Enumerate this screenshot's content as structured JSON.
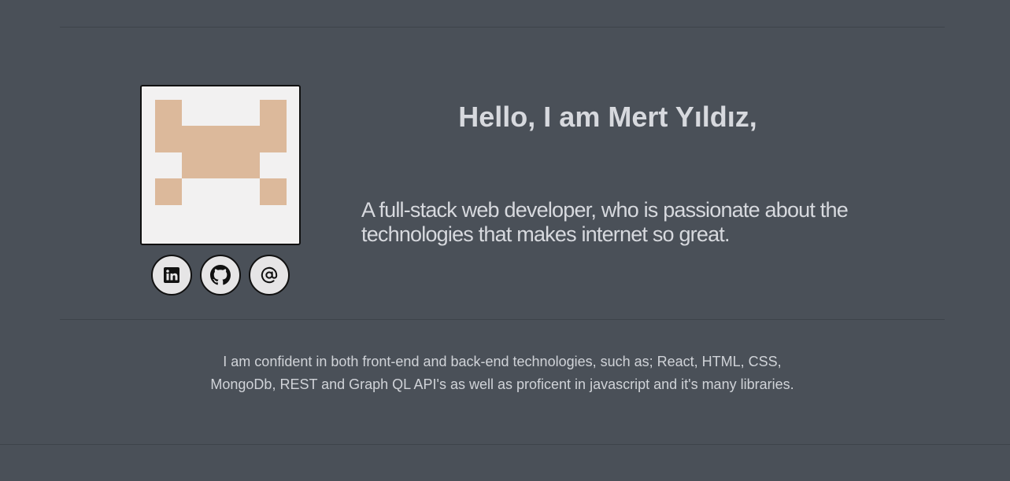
{
  "hero": {
    "greeting": "Hello, I am Mert Yıldız,",
    "tagline": "A full-stack web developer, who is passionate about the technologies that makes internet so great."
  },
  "avatar": {
    "icon": "pixel-space-invader-icon",
    "pixel_color": "#dcb99b",
    "background_color": "#f2f1f1"
  },
  "social_links": [
    {
      "icon": "linkedin-icon"
    },
    {
      "icon": "github-icon"
    },
    {
      "icon": "at-sign-email-icon"
    }
  ],
  "about": {
    "text": "I am confident in both front-end and back-end technologies, such as; React, HTML, CSS, MongoDb, REST and Graph QL API's as well as proficent in javascript and it's many libraries."
  },
  "colors": {
    "background": "#4a5058",
    "text": "#d7d9de",
    "divider": "#3d434a"
  }
}
